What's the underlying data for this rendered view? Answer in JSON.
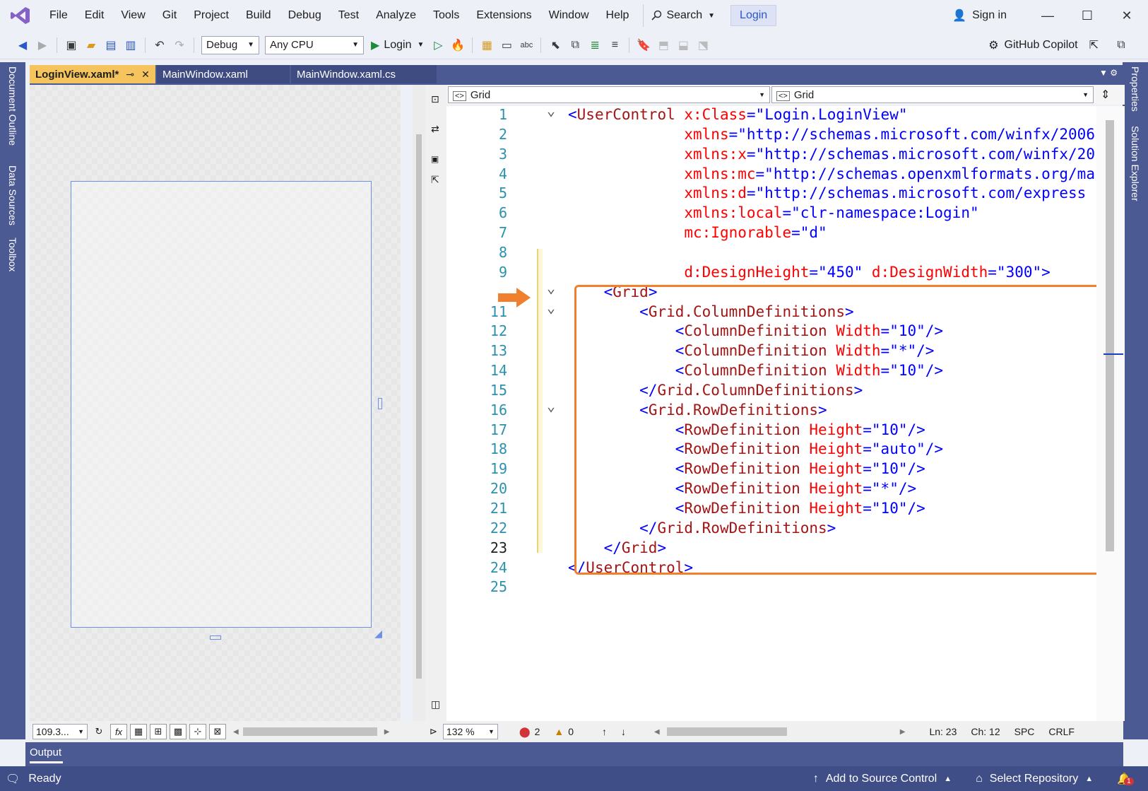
{
  "menubar": {
    "items": [
      "File",
      "Edit",
      "View",
      "Git",
      "Project",
      "Build",
      "Debug",
      "Test",
      "Analyze",
      "Tools",
      "Extensions",
      "Window",
      "Help"
    ],
    "search_label": "Search",
    "solution_name": "Login",
    "signin_label": "Sign in"
  },
  "toolbar": {
    "config": "Debug",
    "platform": "Any CPU",
    "run_label": "Login",
    "copilot_label": "GitHub Copilot"
  },
  "left_rail": [
    "Document Outline",
    "Data Sources",
    "Toolbox"
  ],
  "right_rail": [
    "Properties",
    "Solution Explorer"
  ],
  "tabs": [
    {
      "label": "LoginView.xaml*",
      "active": true
    },
    {
      "label": "MainWindow.xaml",
      "active": false
    },
    {
      "label": "MainWindow.xaml.cs",
      "active": false
    }
  ],
  "editor_nav": {
    "left": "Grid",
    "right": "Grid"
  },
  "code": [
    {
      "n": "1",
      "fold": "v",
      "html": "<span class='t-br'>&lt;</span><span class='t-tag'>UserControl</span> <span class='t-attr'>x:Class</span><span class='t-br'>=\"Login.LoginView\"</span>"
    },
    {
      "n": "2",
      "html": "             <span class='t-attr'>xmlns</span><span class='t-br'>=\"http://schemas.microsoft.com/winfx/2006</span>"
    },
    {
      "n": "3",
      "html": "             <span class='t-attr'>xmlns:x</span><span class='t-br'>=\"http://schemas.microsoft.com/winfx/20</span>"
    },
    {
      "n": "4",
      "html": "             <span class='t-attr'>xmlns:mc</span><span class='t-br'>=\"http://schemas.openxmlformats.org/ma</span>"
    },
    {
      "n": "5",
      "html": "             <span class='t-attr'>xmlns:d</span><span class='t-br'>=\"http://schemas.microsoft.com/express</span>"
    },
    {
      "n": "6",
      "html": "             <span class='t-attr'>xmlns:local</span><span class='t-br'>=\"clr-namespace:Login\"</span>"
    },
    {
      "n": "7",
      "html": "             <span class='t-attr'>mc:Ignorable</span><span class='t-br'>=\"d\"</span>"
    },
    {
      "n": "8",
      "html": ""
    },
    {
      "n": "9",
      "html": "             <span class='t-attr'>d:DesignHeight</span><span class='t-br'>=\"450\"</span> <span class='t-attr'>d:DesignWidth</span><span class='t-br'>=\"300\"&gt;</span>"
    },
    {
      "n": "",
      "fold": "v",
      "html": "    <span class='t-br'>&lt;</span><span class='t-tag'>Grid</span><span class='t-br'>&gt;</span>"
    },
    {
      "n": "11",
      "fold": "v",
      "html": "        <span class='t-br'>&lt;</span><span class='t-tag'>Grid.ColumnDefinitions</span><span class='t-br'>&gt;</span>"
    },
    {
      "n": "12",
      "html": "            <span class='t-br'>&lt;</span><span class='t-tag'>ColumnDefinition</span> <span class='t-attr'>Width</span><span class='t-br'>=\"10\"/&gt;</span>"
    },
    {
      "n": "13",
      "html": "            <span class='t-br'>&lt;</span><span class='t-tag'>ColumnDefinition</span> <span class='t-attr'>Width</span><span class='t-br'>=\"*\"/&gt;</span>"
    },
    {
      "n": "14",
      "html": "            <span class='t-br'>&lt;</span><span class='t-tag'>ColumnDefinition</span> <span class='t-attr'>Width</span><span class='t-br'>=\"10\"/&gt;</span>"
    },
    {
      "n": "15",
      "html": "        <span class='t-br'>&lt;/</span><span class='t-tag'>Grid.ColumnDefinitions</span><span class='t-br'>&gt;</span>"
    },
    {
      "n": "16",
      "fold": "v",
      "html": "        <span class='t-br'>&lt;</span><span class='t-tag'>Grid.RowDefinitions</span><span class='t-br'>&gt;</span>"
    },
    {
      "n": "17",
      "html": "            <span class='t-br'>&lt;</span><span class='t-tag'>RowDefinition</span> <span class='t-attr'>Height</span><span class='t-br'>=\"10\"/&gt;</span>"
    },
    {
      "n": "18",
      "html": "            <span class='t-br'>&lt;</span><span class='t-tag'>RowDefinition</span> <span class='t-attr'>Height</span><span class='t-br'>=\"auto\"/&gt;</span>"
    },
    {
      "n": "19",
      "html": "            <span class='t-br'>&lt;</span><span class='t-tag'>RowDefinition</span> <span class='t-attr'>Height</span><span class='t-br'>=\"10\"/&gt;</span>"
    },
    {
      "n": "20",
      "html": "            <span class='t-br'>&lt;</span><span class='t-tag'>RowDefinition</span> <span class='t-attr'>Height</span><span class='t-br'>=\"*\"/&gt;</span>"
    },
    {
      "n": "21",
      "html": "            <span class='t-br'>&lt;</span><span class='t-tag'>RowDefinition</span> <span class='t-attr'>Height</span><span class='t-br'>=\"10\"/&gt;</span>"
    },
    {
      "n": "22",
      "html": "        <span class='t-br'>&lt;/</span><span class='t-tag'>Grid.RowDefinitions</span><span class='t-br'>&gt;</span>"
    },
    {
      "n": "23",
      "cur": true,
      "html": "    <span class='t-br'>&lt;/</span><span class='t-tag'>Grid</span><span class='t-br'>&gt;</span>"
    },
    {
      "n": "24",
      "html": "<span class='t-br'>&lt;/</span><span class='t-tag'>UserControl</span><span class='t-br'>&gt;</span>"
    },
    {
      "n": "25",
      "html": ""
    }
  ],
  "design_status": {
    "zoom": "109.3..."
  },
  "editor_status": {
    "zoom": "132 %",
    "errors": "2",
    "warnings": "0",
    "ln": "Ln: 23",
    "ch": "Ch: 12",
    "ws": "SPC",
    "eol": "CRLF"
  },
  "output_label": "Output",
  "statusbar": {
    "ready": "Ready",
    "source_control": "Add to Source Control",
    "repository": "Select Repository",
    "notifications": "1"
  },
  "colors": {
    "accent_tab": "#f6c45c",
    "highlight_box": "#f07f2e",
    "chrome": "#4c5a94"
  }
}
